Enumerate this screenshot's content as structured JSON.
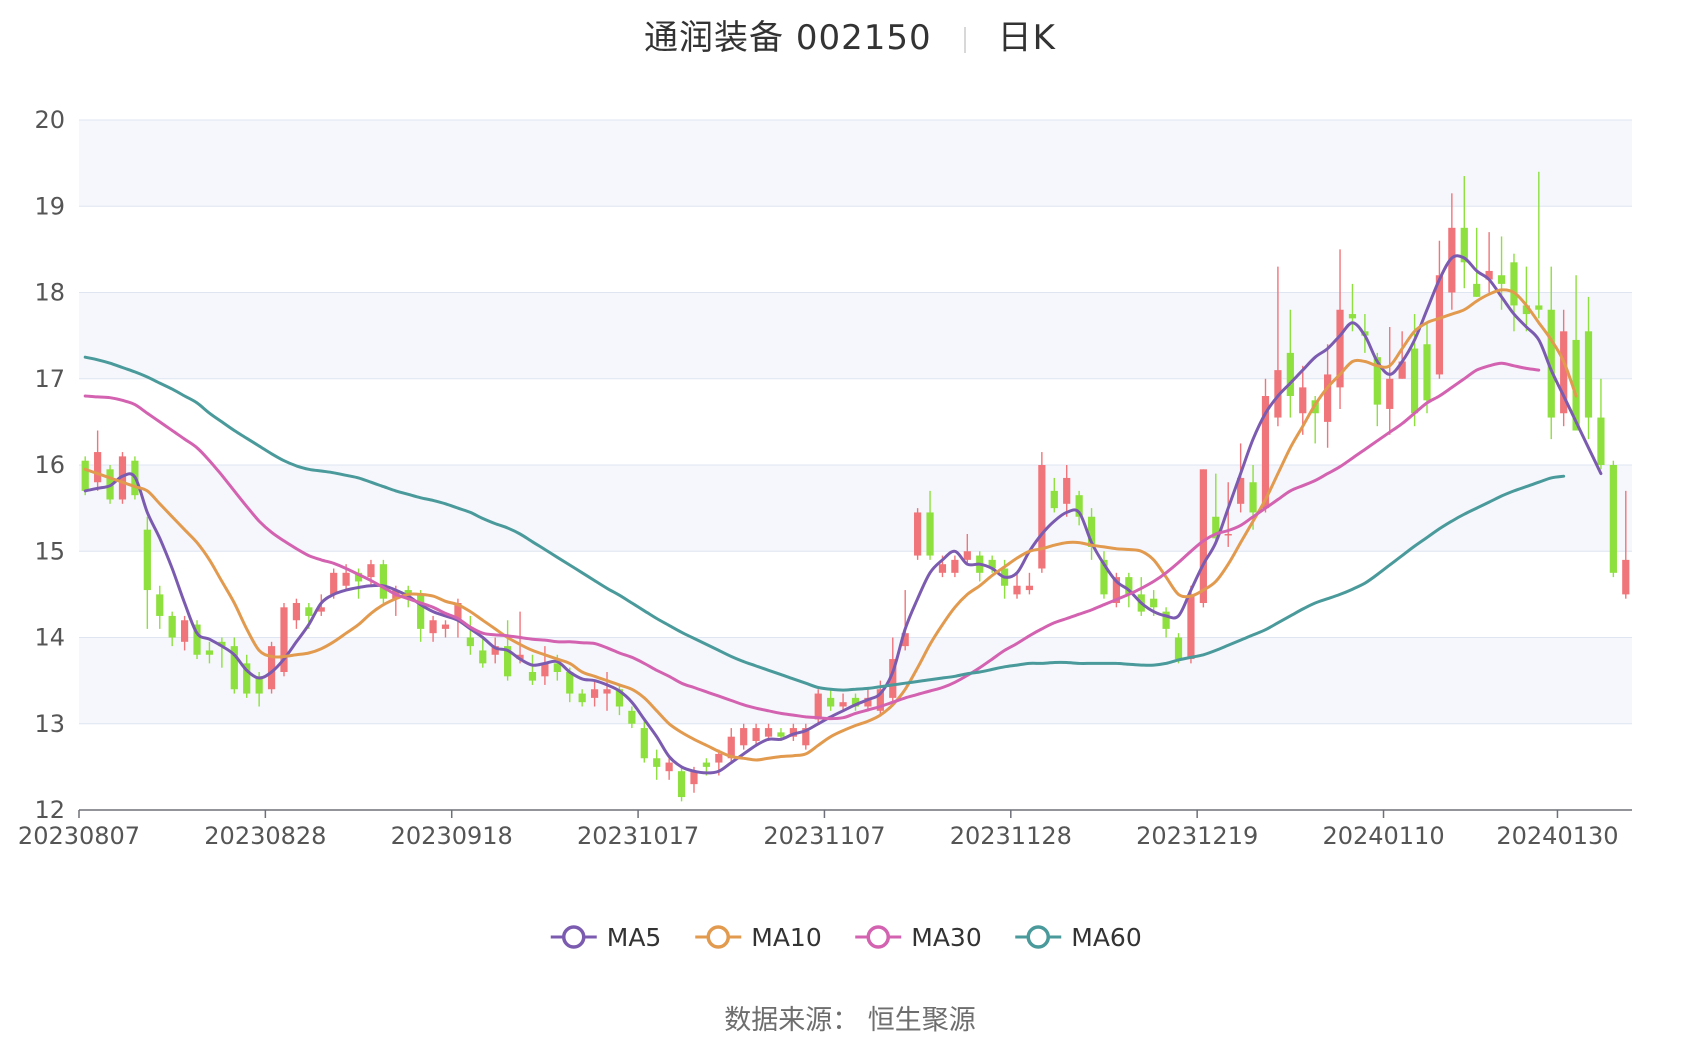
{
  "title": {
    "name": "通润装备",
    "code": "002150",
    "period": "日K"
  },
  "source": {
    "label": "数据来源：",
    "value": "恒生聚源"
  },
  "colors": {
    "up": "#f0757a",
    "down": "#8ee03e",
    "ma5": "#7b5bb0",
    "ma10": "#e29a4f",
    "ma30": "#d362b0",
    "ma60": "#4a9a9b",
    "band": "#f5f7fc",
    "grid": "#dfe5f1"
  },
  "chart_data": {
    "type": "candlestick",
    "ylim": [
      12,
      20
    ],
    "yticks": [
      12,
      13,
      14,
      15,
      16,
      17,
      18,
      19,
      20
    ],
    "x_tick_labels": [
      "20230807",
      "20230828",
      "20230918",
      "20231017",
      "20231107",
      "20231128",
      "20231219",
      "20240110",
      "20240130"
    ],
    "x_tick_positions": [
      0,
      15,
      30,
      45,
      60,
      75,
      90,
      105,
      119
    ],
    "candles": [
      [
        16.05,
        15.7,
        16.1,
        15.65
      ],
      [
        15.8,
        16.15,
        16.4,
        15.7
      ],
      [
        15.95,
        15.6,
        16.0,
        15.55
      ],
      [
        15.6,
        16.1,
        16.15,
        15.55
      ],
      [
        16.05,
        15.65,
        16.1,
        15.6
      ],
      [
        15.25,
        14.55,
        15.4,
        14.1
      ],
      [
        14.5,
        14.25,
        14.6,
        14.1
      ],
      [
        14.25,
        14.0,
        14.3,
        13.9
      ],
      [
        13.95,
        14.2,
        14.25,
        13.85
      ],
      [
        14.15,
        13.8,
        14.2,
        13.75
      ],
      [
        13.85,
        13.8,
        13.95,
        13.7
      ],
      [
        13.95,
        13.9,
        14.0,
        13.65
      ],
      [
        13.9,
        13.4,
        14.0,
        13.35
      ],
      [
        13.7,
        13.35,
        13.8,
        13.3
      ],
      [
        13.55,
        13.35,
        13.6,
        13.2
      ],
      [
        13.4,
        13.9,
        13.95,
        13.35
      ],
      [
        13.6,
        14.35,
        14.4,
        13.55
      ],
      [
        14.2,
        14.4,
        14.45,
        14.1
      ],
      [
        14.35,
        14.25,
        14.4,
        14.1
      ],
      [
        14.3,
        14.35,
        14.5,
        14.25
      ],
      [
        14.5,
        14.75,
        14.8,
        14.45
      ],
      [
        14.6,
        14.75,
        14.85,
        14.55
      ],
      [
        14.75,
        14.65,
        14.8,
        14.45
      ],
      [
        14.7,
        14.85,
        14.9,
        14.6
      ],
      [
        14.85,
        14.45,
        14.9,
        14.4
      ],
      [
        14.45,
        14.55,
        14.6,
        14.25
      ],
      [
        14.55,
        14.5,
        14.6,
        14.35
      ],
      [
        14.5,
        14.1,
        14.55,
        13.95
      ],
      [
        14.05,
        14.2,
        14.25,
        13.95
      ],
      [
        14.1,
        14.15,
        14.2,
        14.0
      ],
      [
        14.2,
        14.4,
        14.45,
        14.0
      ],
      [
        14.0,
        13.9,
        14.25,
        13.8
      ],
      [
        13.85,
        13.7,
        14.0,
        13.65
      ],
      [
        13.8,
        13.9,
        14.0,
        13.7
      ],
      [
        13.9,
        13.55,
        14.2,
        13.5
      ],
      [
        13.75,
        13.8,
        14.3,
        13.7
      ],
      [
        13.6,
        13.5,
        13.8,
        13.45
      ],
      [
        13.55,
        13.7,
        13.9,
        13.45
      ],
      [
        13.7,
        13.6,
        13.8,
        13.5
      ],
      [
        13.6,
        13.35,
        13.65,
        13.25
      ],
      [
        13.35,
        13.25,
        13.4,
        13.2
      ],
      [
        13.3,
        13.4,
        13.5,
        13.2
      ],
      [
        13.35,
        13.4,
        13.6,
        13.15
      ],
      [
        13.4,
        13.2,
        13.45,
        13.1
      ],
      [
        13.15,
        13.0,
        13.2,
        12.95
      ],
      [
        12.95,
        12.6,
        13.05,
        12.55
      ],
      [
        12.6,
        12.5,
        12.7,
        12.35
      ],
      [
        12.45,
        12.55,
        12.6,
        12.35
      ],
      [
        12.45,
        12.15,
        12.5,
        12.1
      ],
      [
        12.3,
        12.45,
        12.5,
        12.2
      ],
      [
        12.55,
        12.5,
        12.6,
        12.4
      ],
      [
        12.55,
        12.65,
        12.7,
        12.4
      ],
      [
        12.6,
        12.85,
        12.95,
        12.55
      ],
      [
        12.75,
        12.95,
        13.0,
        12.7
      ],
      [
        12.8,
        12.95,
        13.0,
        12.75
      ],
      [
        12.85,
        12.95,
        13.0,
        12.8
      ],
      [
        12.9,
        12.85,
        12.95,
        12.8
      ],
      [
        12.85,
        12.95,
        13.0,
        12.8
      ],
      [
        12.75,
        12.95,
        13.0,
        12.7
      ],
      [
        13.05,
        13.35,
        13.4,
        13.0
      ],
      [
        13.3,
        13.2,
        13.4,
        13.15
      ],
      [
        13.2,
        13.25,
        13.35,
        13.15
      ],
      [
        13.3,
        13.2,
        13.35,
        13.15
      ],
      [
        13.2,
        13.3,
        13.4,
        13.15
      ],
      [
        13.15,
        13.4,
        13.5,
        13.1
      ],
      [
        13.3,
        13.75,
        14.0,
        13.25
      ],
      [
        13.9,
        14.05,
        14.55,
        13.85
      ],
      [
        14.95,
        15.45,
        15.5,
        14.9
      ],
      [
        15.45,
        14.95,
        15.7,
        14.9
      ],
      [
        14.75,
        14.85,
        14.95,
        14.7
      ],
      [
        14.75,
        14.9,
        14.95,
        14.7
      ],
      [
        14.9,
        15.0,
        15.2,
        14.85
      ],
      [
        14.95,
        14.75,
        15.0,
        14.65
      ],
      [
        14.9,
        14.8,
        14.95,
        14.75
      ],
      [
        14.8,
        14.6,
        14.9,
        14.45
      ],
      [
        14.5,
        14.6,
        14.75,
        14.45
      ],
      [
        14.55,
        14.6,
        14.75,
        14.5
      ],
      [
        14.8,
        16.0,
        16.15,
        14.75
      ],
      [
        15.7,
        15.5,
        15.85,
        15.45
      ],
      [
        15.55,
        15.85,
        16.0,
        15.4
      ],
      [
        15.65,
        15.4,
        15.7,
        15.3
      ],
      [
        15.4,
        15.05,
        15.5,
        14.9
      ],
      [
        14.9,
        14.5,
        15.0,
        14.45
      ],
      [
        14.4,
        14.7,
        14.75,
        14.35
      ],
      [
        14.7,
        14.5,
        14.75,
        14.35
      ],
      [
        14.5,
        14.3,
        14.7,
        14.25
      ],
      [
        14.45,
        14.35,
        14.55,
        14.25
      ],
      [
        14.3,
        14.1,
        14.35,
        14.0
      ],
      [
        14.0,
        13.75,
        14.05,
        13.7
      ],
      [
        13.75,
        14.5,
        14.6,
        13.7
      ],
      [
        14.4,
        15.95,
        15.95,
        14.35
      ],
      [
        15.4,
        15.15,
        15.9,
        15.1
      ],
      [
        15.2,
        15.2,
        15.8,
        15.05
      ],
      [
        15.55,
        15.85,
        16.25,
        15.45
      ],
      [
        15.8,
        15.45,
        16.0,
        15.25
      ],
      [
        15.5,
        16.8,
        17.0,
        15.45
      ],
      [
        16.55,
        17.1,
        18.3,
        16.45
      ],
      [
        17.3,
        16.8,
        17.8,
        16.55
      ],
      [
        16.6,
        16.9,
        17.15,
        16.35
      ],
      [
        16.75,
        16.6,
        16.8,
        16.25
      ],
      [
        16.5,
        17.05,
        17.4,
        16.2
      ],
      [
        16.9,
        17.8,
        18.5,
        16.65
      ],
      [
        17.75,
        17.7,
        18.1,
        17.55
      ],
      [
        17.55,
        17.5,
        17.75,
        17.3
      ],
      [
        17.25,
        16.7,
        17.3,
        16.45
      ],
      [
        16.65,
        17.0,
        17.6,
        16.35
      ],
      [
        17.0,
        17.2,
        17.55,
        17.0
      ],
      [
        17.35,
        16.6,
        17.75,
        16.45
      ],
      [
        17.4,
        16.75,
        17.65,
        16.6
      ],
      [
        17.05,
        18.2,
        18.6,
        17.0
      ],
      [
        18.0,
        18.75,
        19.15,
        17.8
      ],
      [
        18.75,
        18.35,
        19.35,
        18.05
      ],
      [
        18.1,
        17.95,
        18.75,
        17.95
      ],
      [
        18.15,
        18.25,
        18.7,
        18.0
      ],
      [
        18.2,
        18.1,
        18.65,
        17.8
      ],
      [
        18.35,
        17.85,
        18.45,
        17.55
      ],
      [
        17.85,
        17.75,
        18.3,
        17.55
      ],
      [
        17.85,
        17.8,
        19.4,
        17.7
      ],
      [
        17.8,
        16.55,
        18.3,
        16.3
      ],
      [
        16.6,
        17.55,
        17.8,
        16.45
      ],
      [
        17.45,
        16.4,
        18.2,
        16.4
      ],
      [
        17.55,
        16.55,
        17.95,
        16.3
      ],
      [
        16.55,
        16.0,
        17.0,
        15.95
      ],
      [
        16.0,
        14.75,
        16.05,
        14.7
      ],
      [
        14.5,
        14.9,
        15.7,
        14.45
      ]
    ],
    "series": [
      {
        "name": "MA5",
        "key": "ma5",
        "values": [
          15.7,
          15.73,
          15.76,
          15.87,
          15.86,
          15.45,
          15.15,
          14.8,
          14.4,
          14.05,
          13.98,
          13.9,
          13.8,
          13.62,
          13.53,
          13.6,
          13.75,
          13.95,
          14.15,
          14.4,
          14.5,
          14.55,
          14.58,
          14.6,
          14.6,
          14.55,
          14.48,
          14.38,
          14.3,
          14.25,
          14.2,
          14.1,
          14.0,
          13.88,
          13.85,
          13.75,
          13.68,
          13.7,
          13.72,
          13.6,
          13.52,
          13.5,
          13.45,
          13.38,
          13.25,
          13.05,
          12.85,
          12.62,
          12.5,
          12.45,
          12.43,
          12.45,
          12.55,
          12.65,
          12.75,
          12.82,
          12.82,
          12.88,
          12.92,
          13.0,
          13.08,
          13.15,
          13.22,
          13.28,
          13.35,
          13.6,
          14.1,
          14.45,
          14.75,
          14.9,
          15.0,
          14.85,
          14.85,
          14.8,
          14.7,
          14.75,
          15.0,
          15.2,
          15.35,
          15.45,
          15.45,
          15.1,
          14.85,
          14.65,
          14.55,
          14.4,
          14.3,
          14.25,
          14.25,
          14.55,
          14.85,
          15.1,
          15.5,
          15.9,
          16.3,
          16.6,
          16.8,
          16.95,
          17.1,
          17.25,
          17.35,
          17.5,
          17.65,
          17.5,
          17.2,
          17.05,
          17.2,
          17.45,
          17.8,
          18.15,
          18.4,
          18.4,
          18.25,
          18.15,
          17.95,
          17.75,
          17.6,
          17.45,
          17.1,
          16.8,
          16.5,
          16.2,
          15.9
        ]
      },
      {
        "name": "MA10",
        "key": "ma10",
        "values": [
          15.95,
          15.9,
          15.85,
          15.8,
          15.75,
          15.7,
          15.55,
          15.4,
          15.25,
          15.1,
          14.9,
          14.65,
          14.4,
          14.1,
          13.85,
          13.78,
          13.78,
          13.8,
          13.82,
          13.87,
          13.95,
          14.05,
          14.15,
          14.28,
          14.38,
          14.45,
          14.5,
          14.5,
          14.48,
          14.42,
          14.38,
          14.3,
          14.2,
          14.1,
          14.0,
          13.92,
          13.85,
          13.8,
          13.75,
          13.7,
          13.6,
          13.55,
          13.5,
          13.45,
          13.4,
          13.3,
          13.15,
          13.0,
          12.9,
          12.82,
          12.75,
          12.68,
          12.62,
          12.6,
          12.58,
          12.6,
          12.62,
          12.63,
          12.65,
          12.75,
          12.85,
          12.92,
          12.98,
          13.03,
          13.1,
          13.22,
          13.4,
          13.65,
          13.92,
          14.15,
          14.35,
          14.5,
          14.6,
          14.72,
          14.82,
          14.92,
          15.0,
          15.03,
          15.07,
          15.1,
          15.1,
          15.07,
          15.05,
          15.03,
          15.02,
          15.0,
          14.9,
          14.7,
          14.5,
          14.48,
          14.55,
          14.65,
          14.85,
          15.1,
          15.35,
          15.6,
          15.9,
          16.2,
          16.45,
          16.7,
          16.9,
          17.05,
          17.2,
          17.2,
          17.15,
          17.15,
          17.35,
          17.55,
          17.65,
          17.7,
          17.75,
          17.8,
          17.9,
          17.98,
          18.03,
          18.0,
          17.85,
          17.65,
          17.45,
          17.2,
          16.8
        ]
      },
      {
        "name": "MA30",
        "key": "ma30",
        "values": [
          16.8,
          16.79,
          16.78,
          16.75,
          16.7,
          16.6,
          16.5,
          16.4,
          16.3,
          16.2,
          16.05,
          15.88,
          15.7,
          15.52,
          15.35,
          15.22,
          15.12,
          15.03,
          14.95,
          14.9,
          14.86,
          14.8,
          14.73,
          14.66,
          14.58,
          14.5,
          14.45,
          14.4,
          14.35,
          14.28,
          14.22,
          14.12,
          14.05,
          14.03,
          14.02,
          14.0,
          13.98,
          13.97,
          13.95,
          13.95,
          13.94,
          13.93,
          13.88,
          13.82,
          13.77,
          13.7,
          13.62,
          13.55,
          13.47,
          13.42,
          13.37,
          13.32,
          13.27,
          13.22,
          13.18,
          13.15,
          13.12,
          13.1,
          13.08,
          13.07,
          13.06,
          13.07,
          13.12,
          13.16,
          13.2,
          13.25,
          13.3,
          13.34,
          13.38,
          13.42,
          13.48,
          13.56,
          13.65,
          13.75,
          13.85,
          13.93,
          14.02,
          14.1,
          14.17,
          14.22,
          14.27,
          14.32,
          14.38,
          14.44,
          14.5,
          14.57,
          14.65,
          14.75,
          14.87,
          15.0,
          15.12,
          15.2,
          15.24,
          15.3,
          15.4,
          15.5,
          15.6,
          15.7,
          15.76,
          15.82,
          15.9,
          15.98,
          16.08,
          16.18,
          16.28,
          16.38,
          16.48,
          16.6,
          16.72,
          16.8,
          16.9,
          17.0,
          17.1,
          17.15,
          17.18,
          17.15,
          17.12,
          17.1
        ]
      },
      {
        "name": "MA60",
        "key": "ma60",
        "values": [
          17.25,
          17.22,
          17.18,
          17.13,
          17.08,
          17.02,
          16.95,
          16.88,
          16.8,
          16.72,
          16.6,
          16.5,
          16.4,
          16.31,
          16.22,
          16.13,
          16.05,
          15.99,
          15.95,
          15.93,
          15.91,
          15.88,
          15.85,
          15.8,
          15.75,
          15.7,
          15.66,
          15.62,
          15.59,
          15.55,
          15.5,
          15.45,
          15.38,
          15.32,
          15.27,
          15.2,
          15.11,
          15.02,
          14.93,
          14.84,
          14.75,
          14.66,
          14.57,
          14.49,
          14.4,
          14.31,
          14.22,
          14.14,
          14.06,
          13.99,
          13.92,
          13.85,
          13.78,
          13.72,
          13.67,
          13.62,
          13.57,
          13.52,
          13.47,
          13.42,
          13.4,
          13.39,
          13.4,
          13.41,
          13.43,
          13.45,
          13.47,
          13.49,
          13.51,
          13.53,
          13.55,
          13.58,
          13.6,
          13.63,
          13.66,
          13.68,
          13.7,
          13.7,
          13.71,
          13.71,
          13.7,
          13.7,
          13.7,
          13.7,
          13.69,
          13.68,
          13.68,
          13.7,
          13.74,
          13.77,
          13.8,
          13.85,
          13.91,
          13.97,
          14.03,
          14.09,
          14.17,
          14.25,
          14.33,
          14.4,
          14.45,
          14.5,
          14.56,
          14.63,
          14.73,
          14.84,
          14.95,
          15.06,
          15.16,
          15.26,
          15.35,
          15.43,
          15.5,
          15.57,
          15.64,
          15.7,
          15.75,
          15.8,
          15.85,
          15.87
        ]
      }
    ]
  }
}
